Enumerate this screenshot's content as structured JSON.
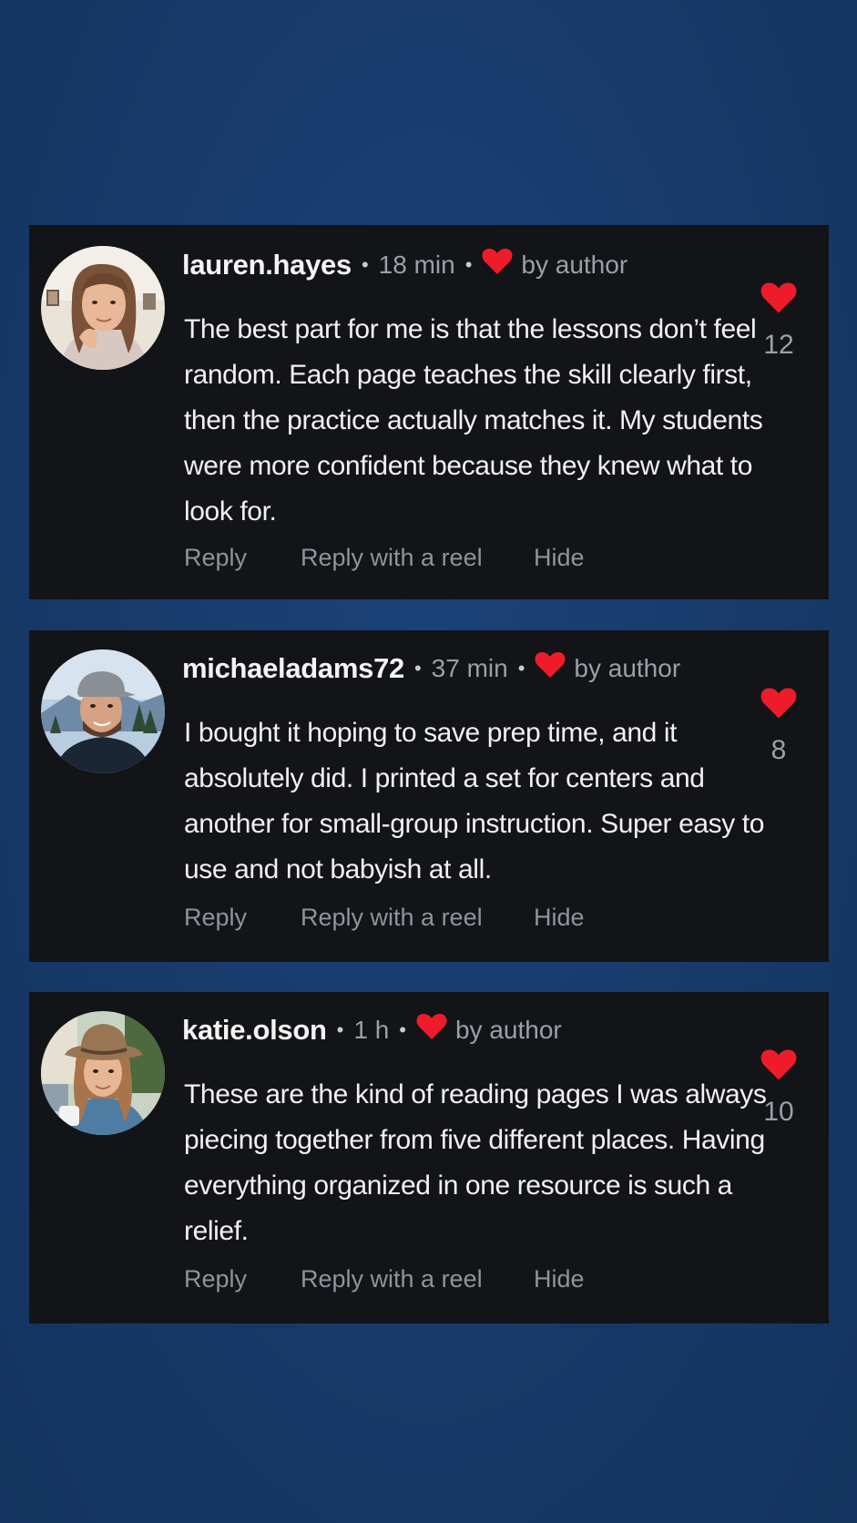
{
  "colors": {
    "background": "#173a6a",
    "card": "#121417",
    "heart": "#ee1c2b",
    "username": "#f4f4f4",
    "meta": "#9aa0a8"
  },
  "comments": [
    {
      "username": "lauren.hayes",
      "time": "18 min",
      "separator": "•",
      "author_badge": "by author",
      "author_badge_icon": "heart-icon",
      "text": "The best part for me is that the lessons don’t feel random. Each page teaches the skill clearly first, then the practice actually matches it. My students were more confident because they knew what to look for.",
      "likes": "12",
      "actions": {
        "reply": "Reply",
        "reply_reel": "Reply with a reel",
        "hide": "Hide"
      }
    },
    {
      "username": "michaeladams72",
      "time": "37 min",
      "separator": "•",
      "author_badge": "by author",
      "author_badge_icon": "heart-icon",
      "text": "I bought it hoping to save prep time, and it absolutely did. I printed a set for centers and another for small-group instruction. Super easy to use and not babyish at all.",
      "likes": "8",
      "actions": {
        "reply": "Reply",
        "reply_reel": "Reply with a reel",
        "hide": "Hide"
      }
    },
    {
      "username": "katie.olson",
      "time": "1 h",
      "separator": "•",
      "author_badge": "by author",
      "author_badge_icon": "heart-icon",
      "text": "These are the kind of reading pages I was always piecing together from five different places. Having everything organized in one resource is such a relief.",
      "likes": "10",
      "actions": {
        "reply": "Reply",
        "reply_reel": "Reply with a reel",
        "hide": "Hide"
      }
    }
  ]
}
